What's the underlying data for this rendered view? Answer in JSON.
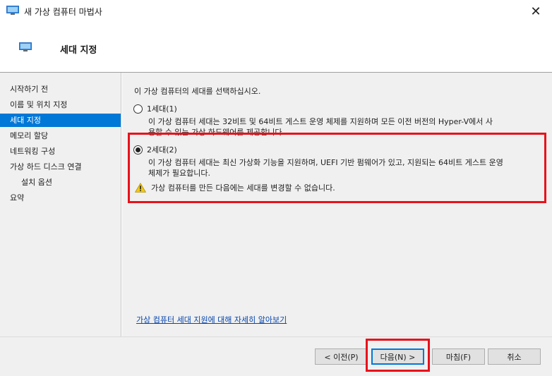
{
  "window": {
    "title": "새 가상 컴퓨터 마법사",
    "close_glyph": "✕",
    "icon": "monitor-icon"
  },
  "header": {
    "title": "세대 지정",
    "icon": "monitor-icon"
  },
  "sidebar": {
    "items": [
      {
        "label": "시작하기 전",
        "active": false
      },
      {
        "label": "이름 및 위치 지정",
        "active": false
      },
      {
        "label": "세대 지정",
        "active": true
      },
      {
        "label": "메모리 할당",
        "active": false
      },
      {
        "label": "네트워킹 구성",
        "active": false
      },
      {
        "label": "가상 하드 디스크 연결",
        "active": false
      },
      {
        "label": "설치 옵션",
        "active": false
      },
      {
        "label": "요약",
        "active": false
      }
    ]
  },
  "content": {
    "intro": "이 가상 컴퓨터의 세대를 선택하십시오.",
    "gen1": {
      "label": "1세대(1)",
      "checked": false,
      "desc_line1": "이 가상 컴퓨터 세대는 32비트 및 64비트 게스트 운영 체제를 지원하며 모든 이전 버전의 Hyper-V에서 사",
      "desc_line2": "용할 수 있는 가상 하드웨어를 제공합니다."
    },
    "gen2": {
      "label": "2세대(2)",
      "checked": true,
      "desc_line1": "이 가상 컴퓨터 세대는 최신 가상화 기능을 지원하며, UEFI 기반 펌웨어가 있고, 지원되는 64비트 게스트 운영",
      "desc_line2": "체제가 필요합니다."
    },
    "warning": "가상 컴퓨터를 만든 다음에는 세대를 변경할 수 없습니다.",
    "learn_link": "가상 컴퓨터 세대 지원에 대해 자세히 알아보기"
  },
  "footer": {
    "prev": "< 이전(P)",
    "next": "다음(N) >",
    "finish": "마침(F)",
    "cancel": "취소"
  },
  "colors": {
    "accent": "#0078d7",
    "highlight": "#e8111b",
    "warning": "#f2c811"
  }
}
